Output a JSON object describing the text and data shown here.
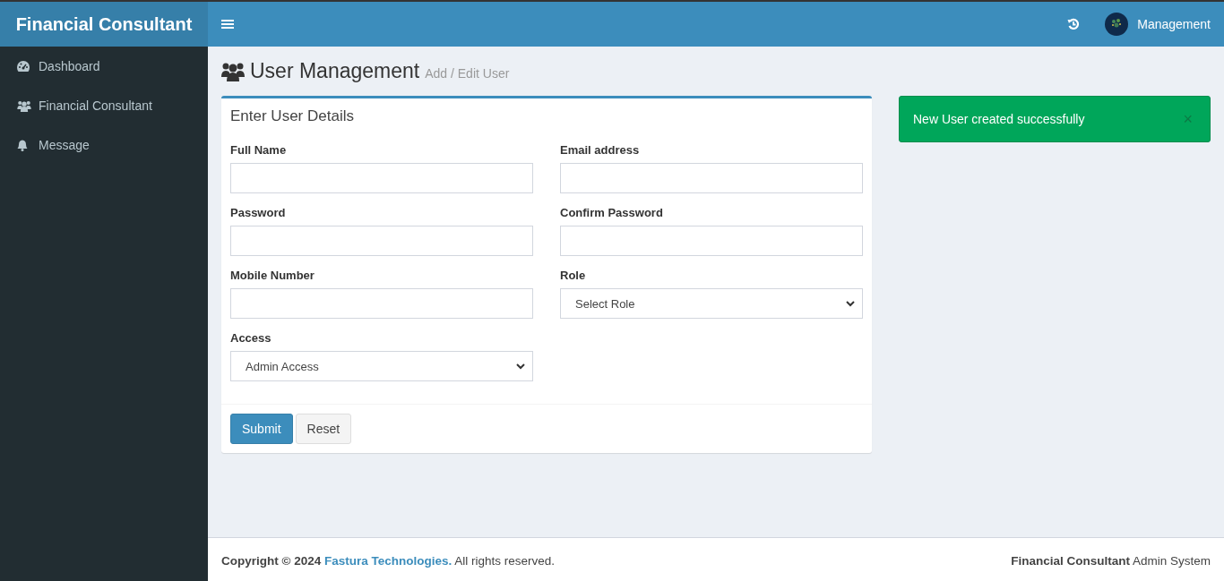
{
  "brand": "Financial Consultant",
  "header": {
    "user_name": "Management"
  },
  "sidebar": {
    "items": [
      {
        "label": "Dashboard",
        "kind": "gauge",
        "selected": false
      },
      {
        "label": "Financial Consultant",
        "kind": "users",
        "selected": false
      },
      {
        "label": "Message",
        "kind": "bell",
        "selected": false
      }
    ]
  },
  "page": {
    "title": "User Management",
    "subtitle": "Add / Edit User"
  },
  "form": {
    "title": "Enter User Details",
    "fields": [
      {
        "label": "Full Name",
        "kind": "input"
      },
      {
        "label": "Email address",
        "kind": "input"
      },
      {
        "label": "Password",
        "kind": "input"
      },
      {
        "label": "Confirm Password",
        "kind": "input"
      },
      {
        "label": "Mobile Number",
        "kind": "input"
      },
      {
        "label": "Role",
        "kind": "select",
        "value": "Select Role"
      },
      {
        "label": "Access",
        "kind": "select",
        "value": "Admin Access"
      }
    ],
    "buttons": [
      {
        "label": "Submit",
        "kind": "primary"
      },
      {
        "label": "Reset",
        "kind": "default"
      }
    ]
  },
  "alert": {
    "message": "New User created successfully",
    "close": "×"
  },
  "footer": {
    "prefix": "**Copyright © 2024** ",
    "link": "Fastura Technologies.",
    "suffix": " All rights reserved.",
    "right": "**Financial Consultant** Admin System"
  }
}
